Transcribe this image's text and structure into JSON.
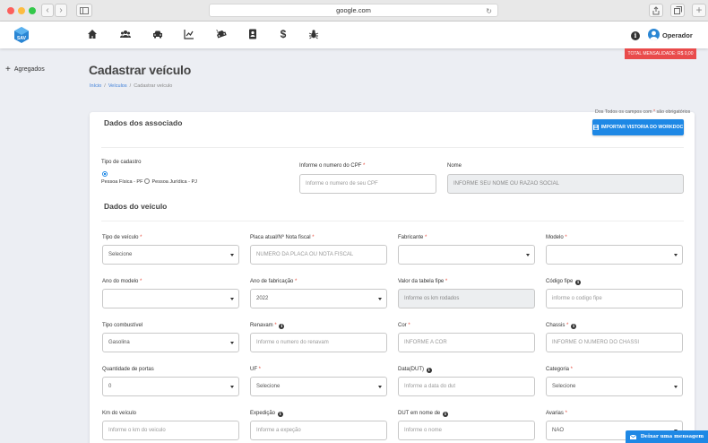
{
  "browser": {
    "url": "google.com",
    "nav_back": "‹",
    "nav_forward": "›"
  },
  "header": {
    "nav_icons": [
      "home-icon",
      "users-icon",
      "car-icon",
      "chart-icon",
      "car-crash-icon",
      "contacts-icon",
      "dollar-icon",
      "bug-icon"
    ],
    "user_name": "Operador"
  },
  "banner": {
    "mensalidade": "TOTAL MENSALIDADE: R$ 0,00"
  },
  "sidebar": {
    "items": [
      {
        "label": "Agregados"
      }
    ]
  },
  "page": {
    "title": "Cadastrar veículo",
    "breadcrumb": [
      "Início",
      "Veículos",
      "Cadastrar veículo"
    ],
    "required_note": "Dos Todos os campos com",
    "required_note_suffix": "são obrigatórios",
    "import_button": "IMPORTAR VISTORIA DO WORKDOC"
  },
  "associado": {
    "title": "Dados dos associado",
    "tipo_label": "Tipo de cadastro",
    "pf_label": "Pessoa Física - PF",
    "pj_label": "Pessoa Jurídica - PJ",
    "cpf_label": "Informe o numero do CPF",
    "cpf_placeholder": "Informe o numero de seu CPF",
    "nome_label": "Nome",
    "nome_placeholder": "INFORME SEU NOME OU RAZAO SOCIAL"
  },
  "veiculo": {
    "title": "Dados do veículo",
    "rows": [
      [
        {
          "label": "Tipo de veículo",
          "req": true,
          "info": false,
          "value": "Selecione",
          "kind": "select"
        },
        {
          "label": "Placa atual/Nº Nota fiscal",
          "req": true,
          "info": false,
          "value": "NUMERO DA PLACA OU NOTA FISCAL",
          "kind": "input"
        },
        {
          "label": "Fabricante",
          "req": true,
          "info": false,
          "value": "",
          "kind": "select"
        },
        {
          "label": "Modelo",
          "req": true,
          "info": false,
          "value": "",
          "kind": "select"
        }
      ],
      [
        {
          "label": "Ano do modelo",
          "req": true,
          "info": false,
          "value": "",
          "kind": "select"
        },
        {
          "label": "Ano de fabricação",
          "req": true,
          "info": false,
          "value": "2022",
          "kind": "select"
        },
        {
          "label": "Valor da tabela fipe",
          "req": true,
          "info": false,
          "value": "Informe os km rodados",
          "kind": "disabled"
        },
        {
          "label": "Código fipe",
          "req": false,
          "info": true,
          "value": "informe o codigo fipe",
          "kind": "input"
        }
      ],
      [
        {
          "label": "Tipo combustível",
          "req": false,
          "info": false,
          "value": "Gasolina",
          "kind": "select"
        },
        {
          "label": "Renavam",
          "req": true,
          "info": true,
          "value": "Informe o numero do renavam",
          "kind": "input"
        },
        {
          "label": "Cor",
          "req": true,
          "info": false,
          "value": "INFORME A COR",
          "kind": "input"
        },
        {
          "label": "Chassis",
          "req": true,
          "info": true,
          "value": "INFORME O NUMERO DO CHASSI",
          "kind": "input"
        }
      ],
      [
        {
          "label": "Quantidade de portas",
          "req": false,
          "info": false,
          "value": "0",
          "kind": "select"
        },
        {
          "label": "UF",
          "req": true,
          "info": false,
          "value": "Selecione",
          "kind": "select"
        },
        {
          "label": "Data(DUT)",
          "req": false,
          "info": true,
          "value": "Informe a data do dut",
          "kind": "input"
        },
        {
          "label": "Categoria",
          "req": true,
          "info": false,
          "value": "Selecione",
          "kind": "select"
        }
      ],
      [
        {
          "label": "Km do veículo",
          "req": false,
          "info": false,
          "value": "Informe o km do veiculo",
          "kind": "input"
        },
        {
          "label": "Expedição",
          "req": false,
          "info": true,
          "value": "Informe a expeção",
          "kind": "input"
        },
        {
          "label": "DUT em nome de",
          "req": false,
          "info": true,
          "value": "Informe o nome",
          "kind": "input"
        },
        {
          "label": "Avarias",
          "req": true,
          "info": false,
          "value": "NAO",
          "kind": "select"
        }
      ]
    ]
  },
  "chat": {
    "label": "Deixar uma mensagem"
  },
  "colors": {
    "primary": "#1e88e5",
    "danger": "#e94b4b"
  }
}
